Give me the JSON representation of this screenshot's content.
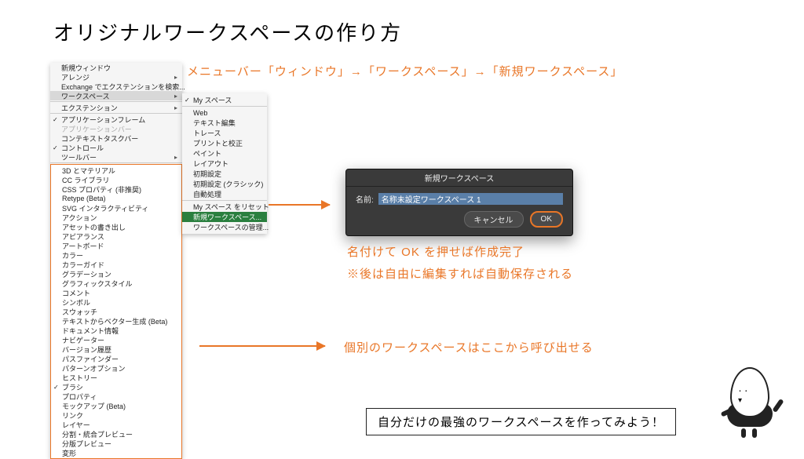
{
  "title": "オリジナルワークスペースの作り方",
  "subtitle": "メニューバー「ウィンドウ」→「ワークスペース」→「新規ワークスペース」",
  "menu": {
    "top": [
      {
        "label": "新規ウィンドウ"
      },
      {
        "label": "アレンジ",
        "arrow": true
      },
      {
        "label": "Exchange でエクステンションを検索..."
      },
      {
        "label": "ワークスペース",
        "arrow": true,
        "active": true
      },
      {
        "sep": true
      },
      {
        "label": "エクステンション",
        "arrow": true
      },
      {
        "sep": true
      },
      {
        "label": "アプリケーションフレーム",
        "checked": true
      },
      {
        "label": "アプリケーションバー",
        "disabled": true
      },
      {
        "label": "コンテキストタスクバー"
      },
      {
        "label": "コントロール",
        "checked": true
      },
      {
        "label": "ツールバー",
        "arrow": true
      }
    ],
    "panels": [
      "3D とマテリアル",
      "CC ライブラリ",
      "CSS プロパティ (非推奨)",
      "Retype (Beta)",
      "SVG インタラクティビティ",
      "アクション",
      "アセットの書き出し",
      "アピアランス",
      "アートボード",
      "カラー",
      "カラーガイド",
      "グラデーション",
      "グラフィックスタイル",
      "コメント",
      "シンボル",
      "スウォッチ",
      "テキストからベクター生成 (Beta)",
      "ドキュメント情報",
      "ナビゲーター",
      "バージョン履歴",
      "パスファインダー",
      "パターンオプション",
      "ヒストリー",
      "ブラシ",
      "プロパティ",
      "モックアップ (Beta)",
      "リンク",
      "レイヤー",
      "分割・統合プレビュー",
      "分版プレビュー",
      "変形"
    ],
    "brush_checked_index": 23
  },
  "submenu": {
    "items": [
      {
        "label": "My スペース",
        "checked": true
      },
      {
        "sep": true
      },
      {
        "label": "Web"
      },
      {
        "label": "テキスト編集"
      },
      {
        "label": "トレース"
      },
      {
        "label": "プリントと校正"
      },
      {
        "label": "ペイント"
      },
      {
        "label": "レイアウト"
      },
      {
        "label": "初期設定"
      },
      {
        "label": "初期設定 (クラシック)"
      },
      {
        "label": "自動処理"
      },
      {
        "sep": true
      },
      {
        "label": "My スペース をリセット"
      },
      {
        "label": "新規ワークスペース...",
        "active": true
      },
      {
        "label": "ワークスペースの管理..."
      }
    ]
  },
  "dialog": {
    "title": "新規ワークスペース",
    "name_label": "名前:",
    "name_value": "名称未設定ワークスペース 1",
    "cancel": "キャンセル",
    "ok": "OK"
  },
  "anno": {
    "line1": "名付けて OK を押せば作成完了",
    "line2": "※後は自由に編集すれば自動保存される",
    "line3": "個別のワークスペースはここから呼び出せる",
    "callout": "自分だけの最強のワークスペースを作ってみよう！"
  }
}
